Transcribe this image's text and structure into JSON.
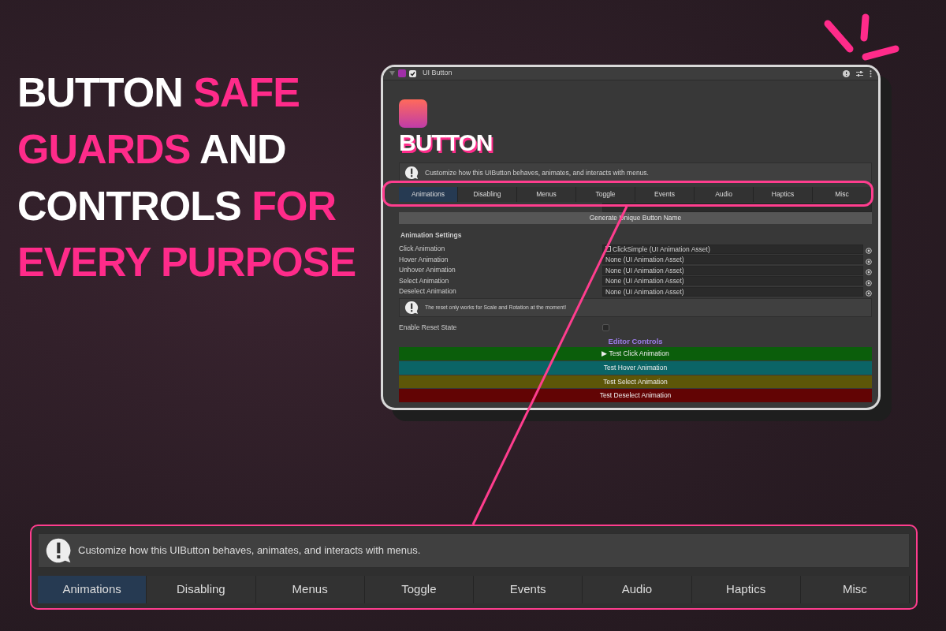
{
  "headline": [
    {
      "text": "BUTTON",
      "accent": false
    },
    {
      "text": "SAFE",
      "accent": true
    },
    {
      "text": "GUARDS",
      "accent": true
    },
    {
      "text": "AND",
      "accent": false
    },
    {
      "text": "CONTROLS",
      "accent": false
    },
    {
      "text": "FOR",
      "accent": true
    },
    {
      "text": "EVERY",
      "accent": true
    },
    {
      "text": "PURPOSE",
      "accent": true
    }
  ],
  "inspector": {
    "title": "UI Button",
    "enabled": true,
    "logo_text": "BUTTON",
    "info": "Customize how this UIButton behaves, animates, and interacts with menus.",
    "tabs": [
      {
        "label": "Animations",
        "selected": true
      },
      {
        "label": "Disabling",
        "selected": false
      },
      {
        "label": "Menus",
        "selected": false
      },
      {
        "label": "Toggle",
        "selected": false
      },
      {
        "label": "Events",
        "selected": false
      },
      {
        "label": "Audio",
        "selected": false
      },
      {
        "label": "Haptics",
        "selected": false
      },
      {
        "label": "Misc",
        "selected": false
      }
    ],
    "generate_button": "Generate Unique Button Name",
    "section_title": "Animation Settings",
    "fields": [
      {
        "label": "Click Animation",
        "value": "ClickSimple (UI Animation Asset)",
        "assigned": true
      },
      {
        "label": "Hover Animation",
        "value": "None (UI Animation Asset)",
        "assigned": false
      },
      {
        "label": "Unhover Animation",
        "value": "None (UI Animation Asset)",
        "assigned": false
      },
      {
        "label": "Select Animation",
        "value": "None (UI Animation Asset)",
        "assigned": false
      },
      {
        "label": "Deselect Animation",
        "value": "None (UI Animation Asset)",
        "assigned": false
      }
    ],
    "warning": "The reset only works for Scale and Rotation at the moment!",
    "reset_toggle": {
      "label": "Enable Reset State",
      "checked": false
    },
    "controls_title": "Editor Controls",
    "controls": [
      {
        "label": "Test Click Animation",
        "prefix": "▶",
        "color": "#0b5e0b"
      },
      {
        "label": "Test Hover Animation",
        "color": "#0b6466"
      },
      {
        "label": "Test Select Animation",
        "color": "#5d5608"
      },
      {
        "label": "Test Deselect Animation",
        "color": "#620404"
      }
    ]
  },
  "callout": {
    "info": "Customize how this UIButton behaves, animates, and interacts with menus.",
    "tabs": [
      {
        "label": "Animations",
        "selected": true
      },
      {
        "label": "Disabling",
        "selected": false
      },
      {
        "label": "Menus",
        "selected": false
      },
      {
        "label": "Toggle",
        "selected": false
      },
      {
        "label": "Events",
        "selected": false
      },
      {
        "label": "Audio",
        "selected": false
      },
      {
        "label": "Haptics",
        "selected": false
      },
      {
        "label": "Misc",
        "selected": false
      }
    ]
  }
}
